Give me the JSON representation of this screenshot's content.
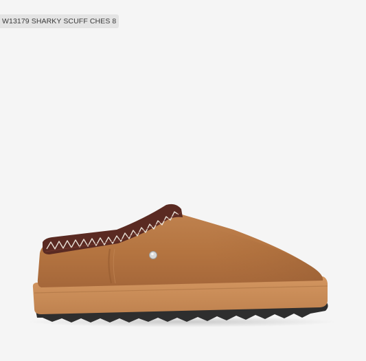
{
  "product": {
    "sku_label": "W13179 SHARKY SCUFF CHES 8"
  },
  "image": {
    "subject_icon": "slipper-shoe",
    "colors": {
      "background": "#f5f5f5",
      "suede": "#b87a45",
      "collar": "#5a2a22",
      "stitch": "#e8e0d6",
      "midsole": "#c98a55",
      "outsole": "#2e2e2e",
      "button": "#d9d9d9"
    }
  }
}
